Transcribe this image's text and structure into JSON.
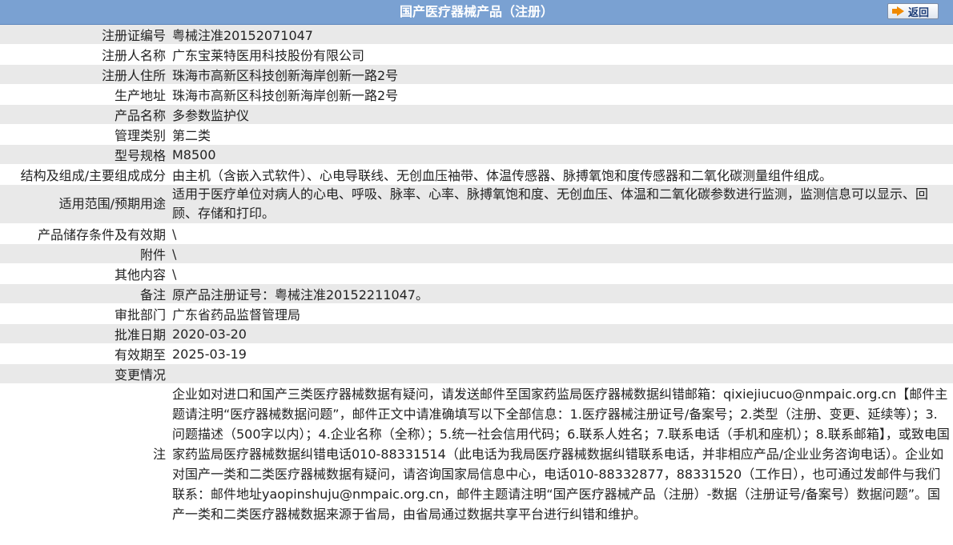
{
  "header": {
    "title": "国产医疗器械产品（注册）",
    "back_label": "返回",
    "back_icon": "arrow-right-icon"
  },
  "rows": [
    {
      "label": "注册证编号",
      "value": "粤械注准20152071047"
    },
    {
      "label": "注册人名称",
      "value": "广东宝莱特医用科技股份有限公司"
    },
    {
      "label": "注册人住所",
      "value": "珠海市高新区科技创新海岸创新一路2号"
    },
    {
      "label": "生产地址",
      "value": "珠海市高新区科技创新海岸创新一路2号"
    },
    {
      "label": "产品名称",
      "value": "多参数监护仪"
    },
    {
      "label": "管理类别",
      "value": "第二类"
    },
    {
      "label": "型号规格",
      "value": "M8500"
    },
    {
      "label": "结构及组成/主要组成成分",
      "value": "由主机（含嵌入式软件）、心电导联线、无创血压袖带、体温传感器、脉搏氧饱和度传感器和二氧化碳测量组件组成。"
    },
    {
      "label": "适用范围/预期用途",
      "value": "适用于医疗单位对病人的心电、呼吸、脉率、心率、脉搏氧饱和度、无创血压、体温和二氧化碳参数进行监测，监测信息可以显示、回顾、存储和打印。"
    },
    {
      "label": "产品储存条件及有效期",
      "value": "\\"
    },
    {
      "label": "附件",
      "value": "\\"
    },
    {
      "label": "其他内容",
      "value": "\\"
    },
    {
      "label": "备注",
      "value": "原产品注册证号：粤械注准20152211047。"
    },
    {
      "label": "审批部门",
      "value": "广东省药品监督管理局"
    },
    {
      "label": "批准日期",
      "value": "2020-03-20"
    },
    {
      "label": "有效期至",
      "value": "2025-03-19"
    },
    {
      "label": "变更情况",
      "value": ""
    }
  ],
  "note": {
    "label": "注",
    "text": "企业如对进口和国产三类医疗器械数据有疑问，请发送邮件至国家药监局医疗器械数据纠错邮箱：qixiejiucuo@nmpaic.org.cn【邮件主题请注明“医疗器械数据问题”，邮件正文中请准确填写以下全部信息：1.医疗器械注册证号/备案号；2.类型（注册、变更、延续等）；3.问题描述（500字以内）；4.企业名称（全称）；5.统一社会信用代码；6.联系人姓名；7.联系电话（手机和座机）；8.联系邮箱】，或致电国家药监局医疗器械数据纠错电话010-88331514（此电话为我局医疗器械数据纠错联系电话，并非相应产品/企业业务咨询电话）。企业如对国产一类和二类医疗器械数据有疑问，请咨询国家局信息中心，电话010-88332877，88331520（工作日），也可通过发邮件与我们联系：邮件地址yaopinshuju@nmpaic.org.cn，邮件主题请注明“国产医疗器械产品（注册）-数据（注册证号/备案号）数据问题”。国产一类和二类医疗器械数据来源于省局，由省局通过数据共享平台进行纠错和维护。"
  }
}
